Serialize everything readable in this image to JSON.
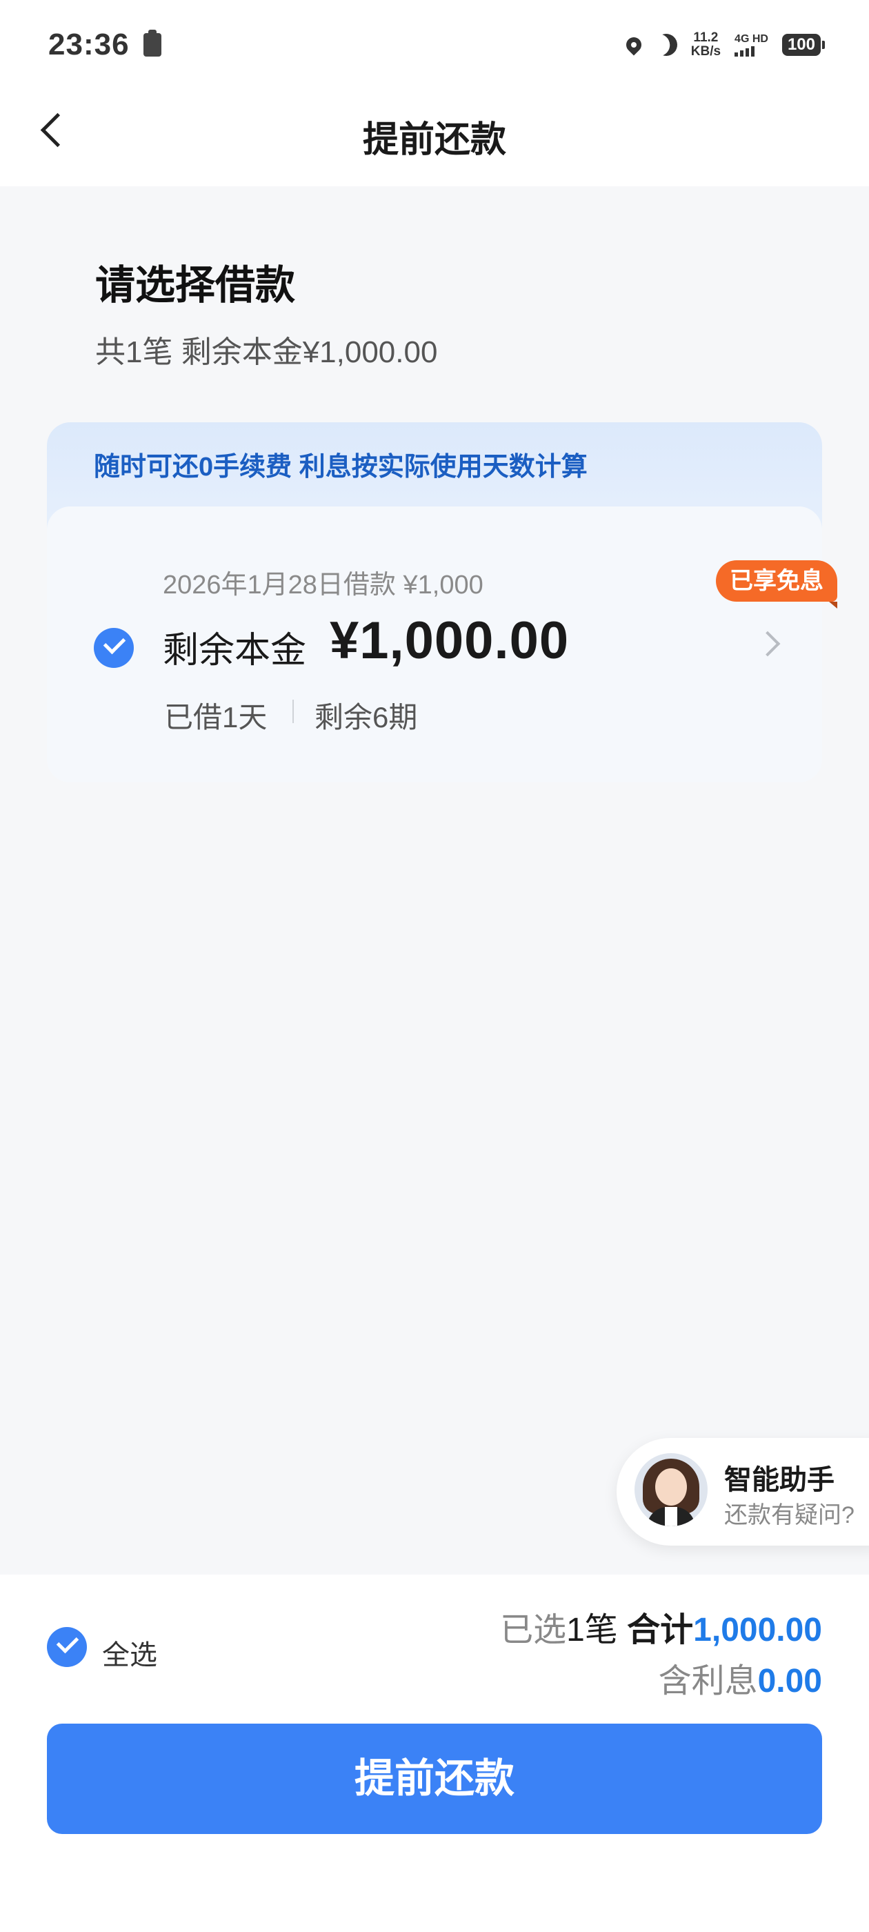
{
  "status_bar": {
    "time": "23:36",
    "net_speed_value": "11.2",
    "net_speed_unit": "KB/s",
    "signal_label": "4G HD",
    "battery": "100"
  },
  "header": {
    "title": "提前还款"
  },
  "section": {
    "title": "请选择借款",
    "summary": "共1笔 剩余本金¥1,000.00"
  },
  "promo": {
    "text": "随时可还0手续费 利息按实际使用天数计算"
  },
  "loan": {
    "date_line": "2026年1月28日借款 ¥1,000",
    "principal_label": "剩余本金",
    "principal_amount": "¥1,000.00",
    "borrowed_days": "已借1天",
    "remaining_periods": "剩余6期",
    "badge": "已享免息",
    "selected": true
  },
  "assistant": {
    "title": "智能助手",
    "subtitle": "还款有疑问?"
  },
  "footer": {
    "select_all_label": "全选",
    "selected_prefix": "已选",
    "selected_count": "1笔",
    "total_label": "合计",
    "total_value": "1,000.00",
    "interest_label": "含利息",
    "interest_value": "0.00",
    "submit_label": "提前还款"
  },
  "colors": {
    "primary": "#3b82f6",
    "badge": "#f56a27",
    "promo_text": "#1b5ec2",
    "amount_blue": "#1f7be8"
  }
}
